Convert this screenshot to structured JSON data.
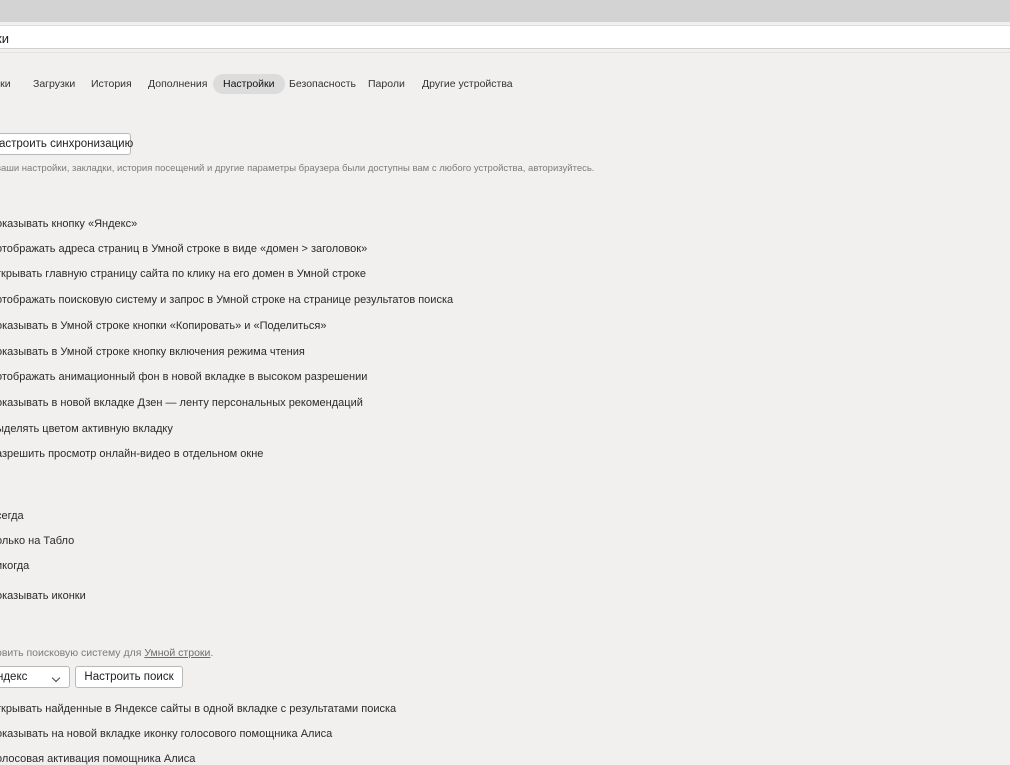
{
  "address_bar": {
    "text": "ки"
  },
  "nav": {
    "tabs": [
      {
        "id": "bookmarks",
        "label": "дки",
        "active": false
      },
      {
        "id": "downloads",
        "label": "Загрузки",
        "active": false
      },
      {
        "id": "history",
        "label": "История",
        "active": false
      },
      {
        "id": "extensions",
        "label": "Дополнения",
        "active": false
      },
      {
        "id": "settings",
        "label": "Настройки",
        "active": true
      },
      {
        "id": "security",
        "label": "Безопасность",
        "active": false
      },
      {
        "id": "passwords",
        "label": "Пароли",
        "active": false
      },
      {
        "id": "devices",
        "label": "Другие устройства",
        "active": false
      }
    ]
  },
  "sync": {
    "button_label": "астроить синхронизацию",
    "hint": "ваши настройки, закладки, история посещений и другие параметры браузера были доступны вам с любого устройства, авторизуйтесь."
  },
  "appearance": {
    "options": [
      "оказывать кнопку «Яндекс»",
      "отображать адреса страниц в Умной строке в виде «домен > заголовок»",
      "ткрывать главную страницу сайта по клику на его домен в Умной строке",
      "отображать поисковую систему и запрос в Умной строке на странице результатов поиска",
      "оказывать в Умной строке кнопки «Копировать» и «Поделиться»",
      "оказывать в Умной строке кнопку включения режима чтения",
      "отображать анимационный фон в новой вкладке в высоком разрешении",
      "оказывать в новой вкладке Дзен — ленту персональных рекомендаций",
      "ыделять цветом активную вкладку",
      "азрешить просмотр онлайн-видео в отдельном окне"
    ]
  },
  "bookmarks_bar": {
    "options": [
      "сегда",
      "олько на Табло",
      "икогда"
    ],
    "show_icons": "оказывать иконки"
  },
  "search": {
    "hint_prefix": "овить поисковую систему для ",
    "hint_link": "Умной строки",
    "hint_suffix": ".",
    "engine_selected": "ндекс",
    "configure_button": "Настроить поиск",
    "options": [
      "ткрывать найденные в Яндексе сайты в одной вкладке с результатами поиска",
      "оказывать на новой вкладке иконку голосового помощника Алиса",
      "олосовая активация помощника Алиса"
    ]
  }
}
